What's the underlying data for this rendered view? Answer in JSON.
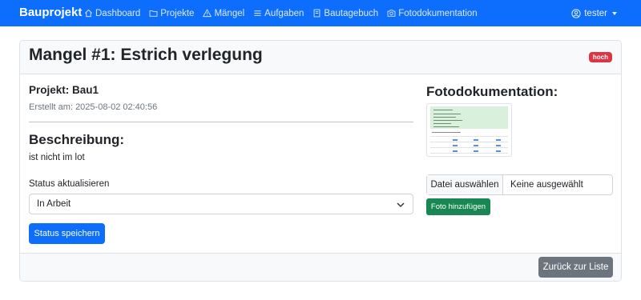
{
  "navbar": {
    "brand": "Bauprojekt",
    "links": [
      {
        "label": "Dashboard",
        "icon": "house-icon"
      },
      {
        "label": "Projekte",
        "icon": "folder-icon"
      },
      {
        "label": "Mängel",
        "icon": "warning-icon"
      },
      {
        "label": "Aufgaben",
        "icon": "list-icon"
      },
      {
        "label": "Bautagebuch",
        "icon": "journal-icon"
      },
      {
        "label": "Fotodokumentation",
        "icon": "camera-icon"
      }
    ],
    "user": "tester",
    "user_icon": "user-circle-icon"
  },
  "defect": {
    "title": "Mangel #1: Estrich verlegung",
    "priority": "hoch",
    "project": "Projekt: Bau1",
    "created": "Erstellt am: 2025-08-02 02:40:56",
    "description_heading": "Beschreibung:",
    "description": "ist nicht im lot"
  },
  "status_form": {
    "label": "Status aktualisieren",
    "selected": "In Arbeit",
    "save_label": "Status speichern"
  },
  "photos": {
    "heading": "Fotodokumentation:",
    "file_button": "Datei auswählen",
    "file_status": "Keine ausgewählt",
    "add_label": "Foto hinzufügen"
  },
  "footer": {
    "back_label": "Zurück zur Liste"
  },
  "colors": {
    "primary": "#0d6efd",
    "danger": "#dc3545",
    "success": "#198754",
    "secondary": "#6c757d"
  }
}
